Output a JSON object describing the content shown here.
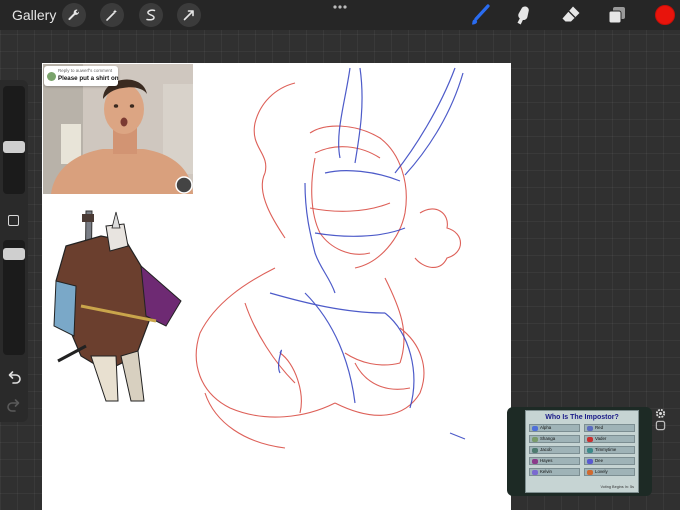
{
  "app": {
    "gallery_label": "Gallery",
    "left_tools": [
      "wrench-icon",
      "magic-wand-icon",
      "selection-icon",
      "transform-arrow-icon"
    ],
    "right_tools": [
      "brush-icon",
      "smudge-icon",
      "eraser-icon",
      "layers-icon"
    ],
    "accent_color": "#2a6cf0",
    "current_color": "#e8140c"
  },
  "reference_photo": {
    "comment_subtitle": "Reply to auwerf's comment",
    "comment_text": "Please put a shirt on"
  },
  "game_reference": {
    "title": "Who Is The Impostor?",
    "players": [
      {
        "name": "Alpha",
        "color": "#4f6fd8"
      },
      {
        "name": "Red",
        "color": "#5b6cc0"
      },
      {
        "name": "Shanga",
        "color": "#7a9b6a"
      },
      {
        "name": "Vader",
        "color": "#c83030"
      },
      {
        "name": "Jacob",
        "color": "#4e7b70"
      },
      {
        "name": "Timmytime",
        "color": "#3d8a8a"
      },
      {
        "name": "Hayes",
        "color": "#8a3b8a"
      },
      {
        "name": "Dee",
        "color": "#5a5ad0"
      },
      {
        "name": "Kelvin",
        "color": "#7a6ad0"
      },
      {
        "name": "Lovely",
        "color": "#d06a30"
      }
    ],
    "footer": "Voting Begins In: 5s"
  }
}
